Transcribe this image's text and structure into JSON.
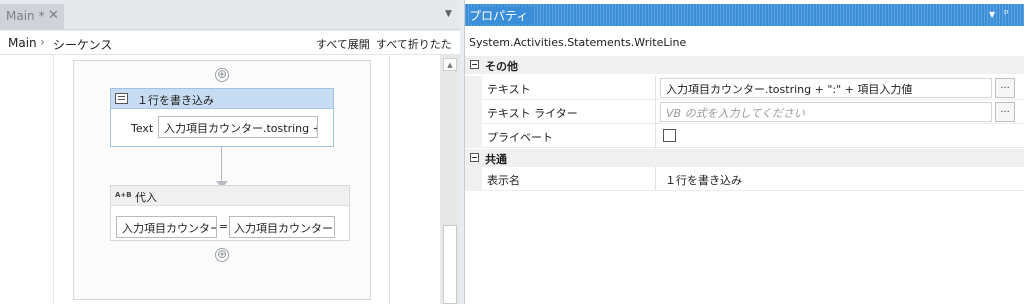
{
  "designer": {
    "tab_label": "Main *",
    "tab_close": "✕",
    "tab_dropdown": "▼",
    "breadcrumb": {
      "root": "Main",
      "separator": "›",
      "current": "シーケンス"
    },
    "expand_all": "すべて展開",
    "collapse_all": "すべて折りたたみ",
    "add_symbol": "⊕",
    "activities": {
      "writeline": {
        "title": "１行を書き込み",
        "text_label": "Text",
        "text_value": "入力項目カウンター.tostring + '"
      },
      "assign": {
        "icon_text": "A+B",
        "title": "代入",
        "left_value": "入力項目カウンター",
        "equals": "=",
        "right_value": "入力項目カウンター+"
      }
    },
    "scroll_up": "▲"
  },
  "properties": {
    "title": "プロパティ",
    "pin": "ᵖ",
    "dropdown": "▼",
    "type_name": "System.Activities.Statements.WriteLine",
    "categories": [
      {
        "name": "その他",
        "rows": [
          {
            "name": "テキスト",
            "value": "入力項目カウンター.tostring + \":\" + 項目入力値",
            "dots": "..."
          },
          {
            "name": "テキスト ライター",
            "placeholder": "VB の式を入力してください",
            "dots": "..."
          },
          {
            "name": "プライベート",
            "checked": false
          }
        ]
      },
      {
        "name": "共通",
        "rows": [
          {
            "name": "表示名",
            "value": "１行を書き込み"
          }
        ]
      }
    ]
  },
  "colors": {
    "panel_title": "#3b8ed8",
    "selected_activity_header": "#c6dcf2"
  }
}
